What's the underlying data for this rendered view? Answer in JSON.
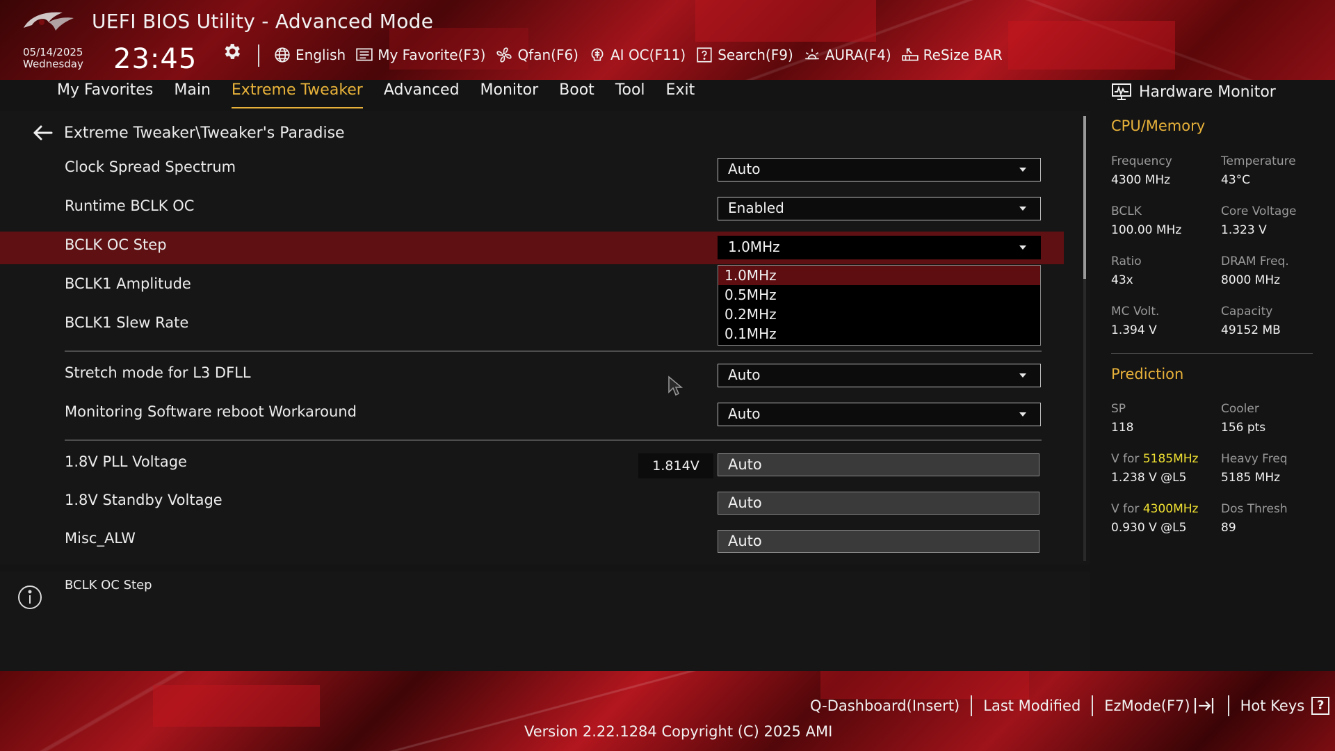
{
  "header": {
    "title": "UEFI BIOS Utility - Advanced Mode",
    "date": "05/14/2025",
    "weekday": "Wednesday",
    "time": "23:45"
  },
  "toolbar": {
    "language": "English",
    "my_favorite": "My Favorite(F3)",
    "qfan": "Qfan(F6)",
    "ai_oc": "AI OC(F11)",
    "search": "Search(F9)",
    "aura": "AURA(F4)",
    "resize_bar": "ReSize BAR"
  },
  "tabs": [
    "My Favorites",
    "Main",
    "Extreme Tweaker",
    "Advanced",
    "Monitor",
    "Boot",
    "Tool",
    "Exit"
  ],
  "active_tab": "Extreme Tweaker",
  "breadcrumb": "Extreme Tweaker\\Tweaker's Paradise",
  "settings": [
    {
      "label": "Clock Spread Spectrum",
      "value": "Auto"
    },
    {
      "label": "Runtime BCLK OC",
      "value": "Enabled"
    },
    {
      "label": "BCLK OC Step",
      "value": "1.0MHz"
    },
    {
      "label": "BCLK1 Amplitude"
    },
    {
      "label": "BCLK1 Slew Rate"
    },
    {
      "label": "Stretch mode for L3 DFLL",
      "value": "Auto"
    },
    {
      "label": "Monitoring Software reboot Workaround",
      "value": "Auto"
    },
    {
      "label": "1.8V PLL Voltage",
      "reading": "1.814V",
      "value": "Auto"
    },
    {
      "label": "1.8V Standby Voltage",
      "value": "Auto"
    },
    {
      "label": "Misc_ALW",
      "value": "Auto"
    }
  ],
  "dropdown": {
    "options": [
      "1.0MHz",
      "0.5MHz",
      "0.2MHz",
      "0.1MHz"
    ],
    "selected": "1.0MHz"
  },
  "help": {
    "text": "BCLK OC Step"
  },
  "hardware_monitor": {
    "title": "Hardware Monitor",
    "cpu_memory": {
      "heading": "CPU/Memory",
      "items": [
        {
          "label": "Frequency",
          "value": "4300 MHz"
        },
        {
          "label": "Temperature",
          "value": "43°C"
        },
        {
          "label": "BCLK",
          "value": "100.00 MHz"
        },
        {
          "label": "Core Voltage",
          "value": "1.323 V"
        },
        {
          "label": "Ratio",
          "value": "43x"
        },
        {
          "label": "DRAM Freq.",
          "value": "8000 MHz"
        },
        {
          "label": "MC Volt.",
          "value": "1.394 V"
        },
        {
          "label": "Capacity",
          "value": "49152 MB"
        }
      ]
    },
    "prediction": {
      "heading": "Prediction",
      "sp_label": "SP",
      "sp_value": "118",
      "cooler_label": "Cooler",
      "cooler_value": "156 pts",
      "vfor_prefix": "V for",
      "v1_freq": "5185MHz",
      "v1_value": "1.238 V @L5",
      "heavy_label": "Heavy Freq",
      "heavy_value": "5185 MHz",
      "v2_freq": "4300MHz",
      "v2_value": "0.930 V @L5",
      "dos_label": "Dos Thresh",
      "dos_value": "89"
    }
  },
  "footer": {
    "qdashboard": "Q-Dashboard(Insert)",
    "last_modified": "Last Modified",
    "ezmode": "EzMode(F7)",
    "hotkeys": "Hot Keys",
    "hotkeys_symbol": "?",
    "version": "Version 2.22.1284 Copyright (C) 2025 AMI"
  },
  "colors": {
    "accent": "#e8b23a",
    "highlight_row": "#5e1012",
    "frequency_highlight": "#f0e132",
    "brand_red": "#a3141b"
  }
}
